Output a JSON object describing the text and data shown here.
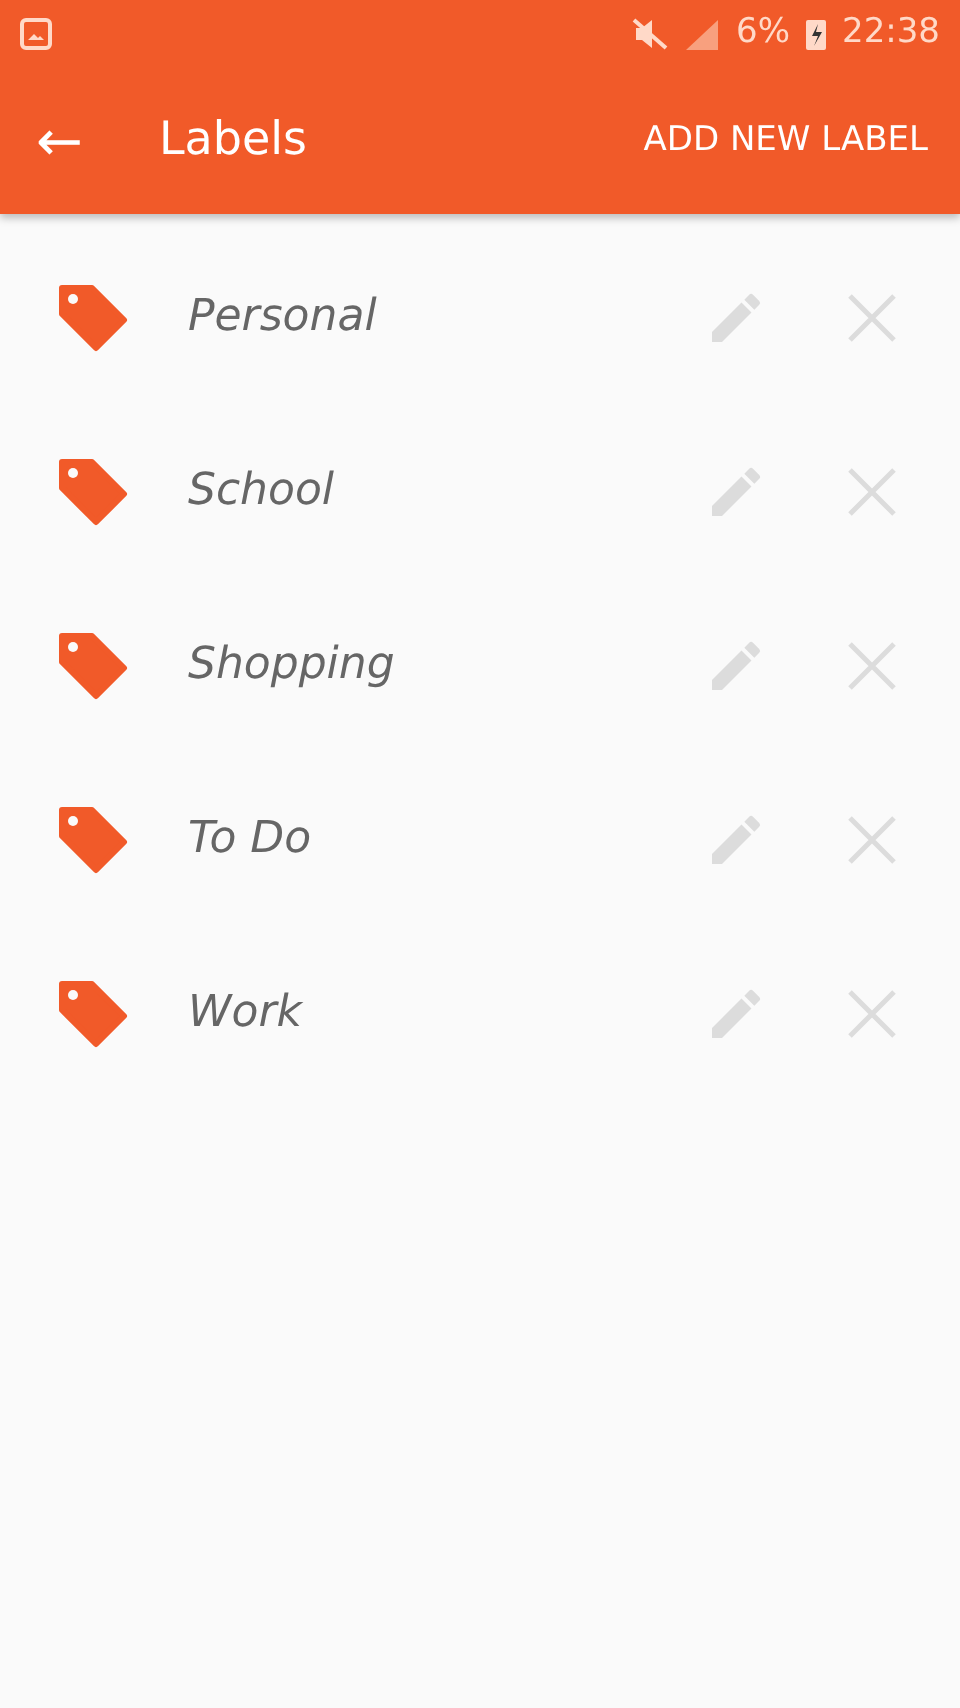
{
  "status_bar": {
    "battery": "6%",
    "time": "22:38"
  },
  "app_bar": {
    "back": "←",
    "title": "Labels",
    "action": "ADD NEW LABEL"
  },
  "labels": [
    {
      "name": "Personal"
    },
    {
      "name": "School"
    },
    {
      "name": "Shopping"
    },
    {
      "name": "To Do"
    },
    {
      "name": "Work"
    }
  ]
}
